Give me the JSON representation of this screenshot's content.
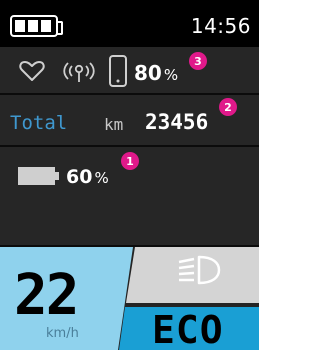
{
  "status_bar": {
    "time": "14:56",
    "battery_icon": "battery-full-icon"
  },
  "connectivity_row": {
    "icons": [
      "heart-icon",
      "wireless-signal-icon",
      "smartphone-icon"
    ],
    "phone_battery_value": "80",
    "phone_battery_unit": "%",
    "badge": "3"
  },
  "odometer_row": {
    "label": "Total",
    "unit": "km",
    "value": "23456",
    "badge": "2"
  },
  "battery_row": {
    "icon": "battery-icon",
    "value": "60",
    "unit": "%",
    "badge": "1"
  },
  "speed": {
    "value": "22",
    "unit": "km/h"
  },
  "assist": {
    "mode": "ECO",
    "light_icon": "headlight-icon"
  },
  "colors": {
    "accent_blue": "#3f98cf",
    "speed_panel": "#8fd2ed",
    "mode_panel": "#1a9fd4",
    "badge_pink": "#e0198a",
    "light_panel": "#d4d4d4"
  }
}
